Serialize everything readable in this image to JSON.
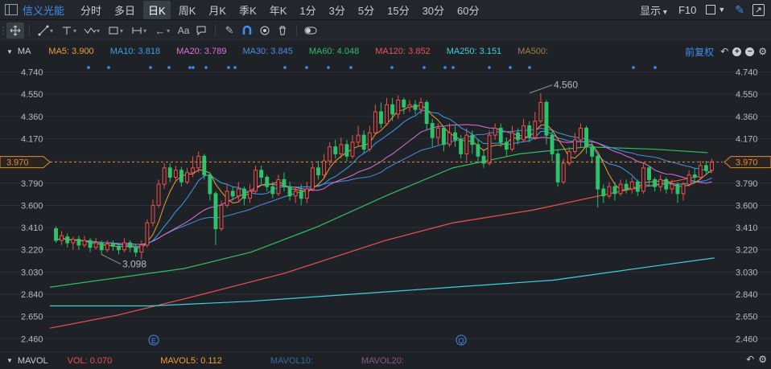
{
  "toolbar": {
    "stock_name": "信义光能",
    "periods": [
      "分时",
      "多日",
      "日K",
      "周K",
      "月K",
      "季K",
      "年K",
      "1分",
      "3分",
      "5分",
      "15分",
      "30分",
      "60分"
    ],
    "active_period": 2,
    "display_label": "显示",
    "f10_label": "F10"
  },
  "legend": {
    "indicator": "MA",
    "items": [
      {
        "label": "MA5: 3.900",
        "color": "#f0a030"
      },
      {
        "label": "MA10: 3.818",
        "color": "#3f9ef0"
      },
      {
        "label": "MA20: 3.789",
        "color": "#e070e0"
      },
      {
        "label": "MA30: 3.845",
        "color": "#4a90e0"
      },
      {
        "label": "MA60: 4.048",
        "color": "#30c060"
      },
      {
        "label": "MA120: 3.852",
        "color": "#f05050"
      },
      {
        "label": "MA250: 3.151",
        "color": "#40d0e0"
      },
      {
        "label": "MA500:",
        "color": "#a08050"
      }
    ],
    "adjust_label": "前复权"
  },
  "chart_data": {
    "type": "candlestick",
    "y_ticks": [
      "4.740",
      "4.550",
      "4.360",
      "4.170",
      "3.980",
      "3.790",
      "3.600",
      "3.410",
      "3.220",
      "3.030",
      "2.840",
      "2.650",
      "2.460"
    ],
    "ylim": [
      2.4,
      4.84
    ],
    "current_price": "3.970",
    "high_annotation": "4.560",
    "low_annotation": "3.098",
    "event_markers": [
      "E",
      "Q"
    ],
    "candles": [
      [
        3.4,
        3.3,
        3.42,
        3.28
      ],
      [
        3.3,
        3.34,
        3.38,
        3.26
      ],
      [
        3.33,
        3.28,
        3.36,
        3.24
      ],
      [
        3.28,
        3.31,
        3.33,
        3.22
      ],
      [
        3.31,
        3.26,
        3.34,
        3.22
      ],
      [
        3.26,
        3.3,
        3.34,
        3.24
      ],
      [
        3.3,
        3.24,
        3.32,
        3.2
      ],
      [
        3.24,
        3.28,
        3.32,
        3.22
      ],
      [
        3.28,
        3.22,
        3.3,
        3.18
      ],
      [
        3.22,
        3.27,
        3.3,
        3.2
      ],
      [
        3.27,
        3.25,
        3.3,
        3.21
      ],
      [
        3.25,
        3.22,
        3.28,
        3.18
      ],
      [
        3.22,
        3.28,
        3.32,
        3.2
      ],
      [
        3.28,
        3.24,
        3.3,
        3.2
      ],
      [
        3.24,
        3.2,
        3.27,
        3.16
      ],
      [
        3.2,
        3.26,
        3.3,
        3.14
      ],
      [
        3.26,
        3.45,
        3.48,
        3.24
      ],
      [
        3.45,
        3.6,
        3.65,
        3.42
      ],
      [
        3.6,
        3.78,
        3.82,
        3.58
      ],
      [
        3.78,
        3.92,
        3.96,
        3.74
      ],
      [
        3.92,
        3.84,
        3.96,
        3.8
      ],
      [
        3.84,
        3.9,
        3.94,
        3.8
      ],
      [
        3.9,
        3.8,
        3.93,
        3.76
      ],
      [
        3.8,
        3.88,
        3.92,
        3.78
      ],
      [
        3.88,
        3.92,
        4.02,
        3.84
      ],
      [
        3.92,
        4.02,
        4.06,
        3.88
      ],
      [
        4.02,
        3.86,
        4.04,
        3.82
      ],
      [
        3.86,
        3.7,
        3.88,
        3.64
      ],
      [
        3.7,
        3.4,
        3.72,
        3.26
      ],
      [
        3.4,
        3.6,
        3.64,
        3.38
      ],
      [
        3.6,
        3.72,
        3.78,
        3.58
      ],
      [
        3.72,
        3.68,
        3.76,
        3.64
      ],
      [
        3.68,
        3.74,
        3.8,
        3.64
      ],
      [
        3.74,
        3.66,
        3.76,
        3.6
      ],
      [
        3.66,
        3.72,
        3.78,
        3.62
      ],
      [
        3.72,
        3.9,
        3.94,
        3.7
      ],
      [
        3.9,
        3.84,
        3.94,
        3.78
      ],
      [
        3.84,
        3.76,
        3.86,
        3.72
      ],
      [
        3.76,
        3.7,
        3.8,
        3.66
      ],
      [
        3.7,
        3.82,
        3.86,
        3.68
      ],
      [
        3.82,
        3.76,
        3.88,
        3.72
      ],
      [
        3.76,
        3.68,
        3.8,
        3.64
      ],
      [
        3.68,
        3.72,
        3.76,
        3.62
      ],
      [
        3.72,
        3.66,
        3.78,
        3.6
      ],
      [
        3.66,
        3.74,
        3.8,
        3.62
      ],
      [
        3.74,
        3.92,
        3.96,
        3.72
      ],
      [
        3.92,
        3.86,
        3.98,
        3.82
      ],
      [
        3.86,
        3.98,
        4.04,
        3.84
      ],
      [
        3.98,
        4.1,
        4.14,
        3.94
      ],
      [
        4.1,
        4.04,
        4.16,
        4.0
      ],
      [
        4.04,
        4.12,
        4.18,
        4.0
      ],
      [
        4.12,
        4.02,
        4.16,
        3.98
      ],
      [
        4.02,
        4.14,
        4.2,
        4.0
      ],
      [
        4.14,
        4.2,
        4.28,
        4.1
      ],
      [
        4.2,
        4.08,
        4.24,
        4.04
      ],
      [
        4.08,
        4.22,
        4.28,
        4.06
      ],
      [
        4.22,
        4.4,
        4.46,
        4.2
      ],
      [
        4.4,
        4.3,
        4.48,
        4.26
      ],
      [
        4.3,
        4.46,
        4.52,
        4.28
      ],
      [
        4.46,
        4.38,
        4.52,
        4.32
      ],
      [
        4.38,
        4.5,
        4.54,
        4.34
      ],
      [
        4.5,
        4.44,
        4.52,
        4.38
      ],
      [
        4.44,
        4.46,
        4.5,
        4.4
      ],
      [
        4.46,
        4.42,
        4.5,
        4.38
      ],
      [
        4.42,
        4.48,
        4.52,
        4.38
      ],
      [
        4.48,
        4.3,
        4.5,
        4.24
      ],
      [
        4.3,
        4.18,
        4.34,
        4.1
      ],
      [
        4.18,
        4.26,
        4.3,
        4.12
      ],
      [
        4.26,
        4.12,
        4.28,
        4.06
      ],
      [
        4.12,
        4.22,
        4.3,
        4.1
      ],
      [
        4.22,
        4.16,
        4.28,
        4.1
      ],
      [
        4.16,
        4.04,
        4.2,
        4.0
      ],
      [
        4.04,
        4.2,
        4.26,
        3.98
      ],
      [
        4.2,
        4.12,
        4.24,
        4.04
      ],
      [
        4.12,
        4.02,
        4.16,
        3.96
      ],
      [
        4.02,
        3.96,
        4.08,
        3.92
      ],
      [
        3.96,
        4.2,
        4.24,
        3.94
      ],
      [
        4.2,
        4.26,
        4.3,
        4.16
      ],
      [
        4.26,
        4.14,
        4.3,
        4.1
      ],
      [
        4.14,
        4.08,
        4.18,
        4.02
      ],
      [
        4.08,
        4.22,
        4.28,
        4.06
      ],
      [
        4.22,
        4.16,
        4.26,
        4.12
      ],
      [
        4.16,
        4.28,
        4.34,
        4.14
      ],
      [
        4.28,
        4.18,
        4.32,
        4.14
      ],
      [
        4.18,
        4.32,
        4.4,
        4.16
      ],
      [
        4.32,
        4.48,
        4.56,
        4.3
      ],
      [
        4.48,
        4.2,
        4.5,
        4.12
      ],
      [
        4.2,
        4.04,
        4.24,
        3.98
      ],
      [
        4.04,
        3.8,
        4.08,
        3.76
      ],
      [
        3.8,
        3.96,
        4.0,
        3.78
      ],
      [
        3.96,
        4.06,
        4.1,
        3.94
      ],
      [
        4.06,
        4.16,
        4.22,
        4.04
      ],
      [
        4.16,
        4.26,
        4.3,
        4.1
      ],
      [
        4.26,
        4.1,
        4.28,
        4.04
      ],
      [
        4.1,
        4.02,
        4.14,
        3.96
      ],
      [
        4.02,
        3.74,
        4.04,
        3.58
      ],
      [
        3.74,
        3.68,
        3.78,
        3.62
      ],
      [
        3.68,
        3.76,
        3.8,
        3.66
      ],
      [
        3.76,
        3.7,
        3.8,
        3.64
      ],
      [
        3.7,
        3.78,
        3.82,
        3.68
      ],
      [
        3.78,
        3.74,
        3.82,
        3.7
      ],
      [
        3.74,
        3.8,
        3.84,
        3.7
      ],
      [
        3.8,
        3.72,
        3.82,
        3.68
      ],
      [
        3.72,
        3.92,
        3.96,
        3.7
      ],
      [
        3.92,
        3.82,
        3.94,
        3.76
      ],
      [
        3.82,
        3.76,
        3.84,
        3.72
      ],
      [
        3.76,
        3.82,
        3.86,
        3.72
      ],
      [
        3.82,
        3.74,
        3.84,
        3.7
      ],
      [
        3.74,
        3.78,
        3.82,
        3.7
      ],
      [
        3.78,
        3.7,
        3.8,
        3.62
      ],
      [
        3.7,
        3.78,
        3.8,
        3.64
      ],
      [
        3.78,
        3.86,
        3.9,
        3.76
      ],
      [
        3.86,
        3.84,
        3.92,
        3.8
      ],
      [
        3.84,
        3.94,
        3.98,
        3.82
      ],
      [
        3.94,
        3.9,
        3.98,
        3.86
      ],
      [
        3.9,
        3.97,
        4.0,
        3.88
      ]
    ]
  },
  "mavol": {
    "indicator": "MAVOL",
    "items": [
      {
        "label": "VOL: 0.070",
        "color": "#f05050"
      },
      {
        "label": "MAVOL5: 0.112",
        "color": "#f0a030"
      },
      {
        "label": "MAVOL10:",
        "color": "#3a6a9a"
      },
      {
        "label": "MAVOL20:",
        "color": "#8a5a8a"
      }
    ]
  }
}
